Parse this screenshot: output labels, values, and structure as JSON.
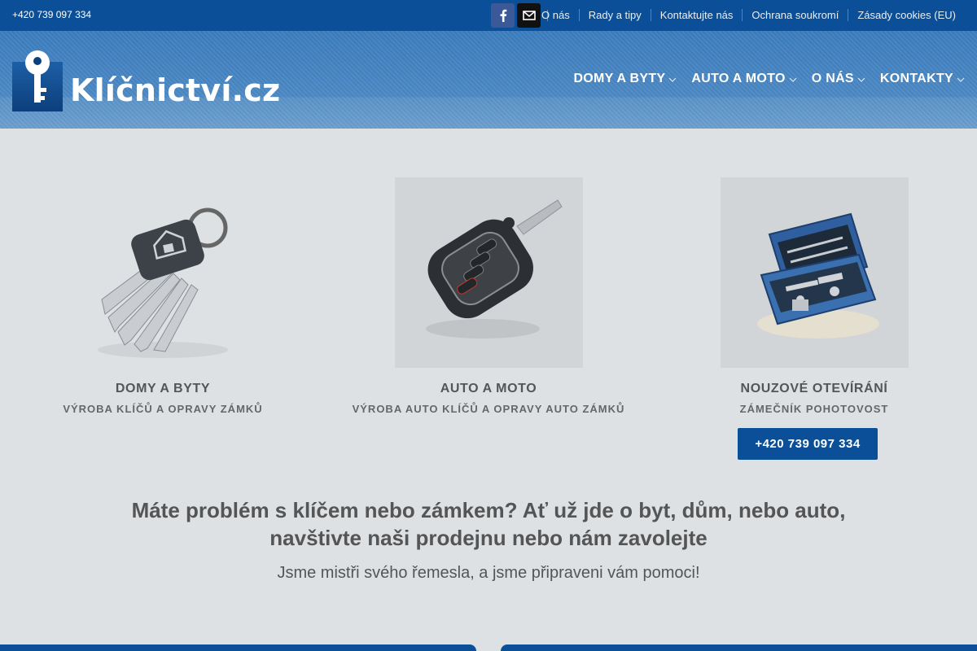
{
  "topbar": {
    "phone": "+420 739 097 334",
    "social": [
      {
        "icon": "facebook-icon"
      },
      {
        "icon": "envelope-icon"
      }
    ],
    "links": [
      "O nás",
      "Rady a tipy",
      "Kontaktujte nás",
      "Ochrana soukromí",
      "Zásady cookies (EU)"
    ]
  },
  "header": {
    "logo_text": "Klíčnictví.cz",
    "nav": [
      "DOMY A BYTY",
      "AUTO A MOTO",
      "O NÁS",
      "KONTAKTY"
    ]
  },
  "categories": [
    {
      "title": "DOMY A BYTY",
      "subtitle": "VÝROBA KLÍČŮ A OPRAVY ZÁMKŮ",
      "image": "house-keys-image"
    },
    {
      "title": "AUTO A MOTO",
      "subtitle": "VÝROBA AUTO KLÍČŮ A OPRAVY AUTO ZÁMKŮ",
      "image": "car-key-image"
    },
    {
      "title": "NOUZOVÉ OTEVÍRÁNÍ",
      "subtitle": "ZÁMEČNÍK POHOTOVOST",
      "image": "toolbox-image",
      "button": "+420 739 097 334"
    }
  ],
  "main": {
    "headline_line1": "Máte problém s klíčem nebo zámkem? Ať už jde o byt, dům, nebo auto,",
    "headline_line2": "navštivte naši prodejnu nebo nám zavolejte",
    "subline": "Jsme mistři svého řemesla, a jsme připraveni vám pomoci!"
  },
  "colors": {
    "brand_blue": "#0a4f98",
    "header_blue": "#4c89c4",
    "page_bg": "#dde1e4",
    "text_gray": "#555555"
  }
}
